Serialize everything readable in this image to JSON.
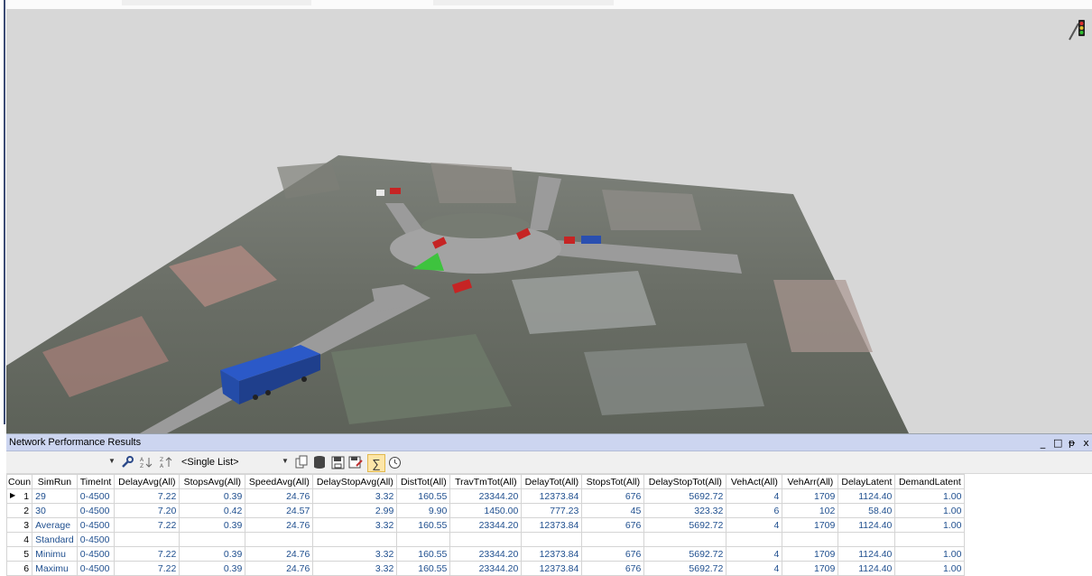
{
  "panel": {
    "title": "Network Performance Results",
    "controls": {
      "minimize": "_",
      "maximize": "□",
      "pin": "ᵽ",
      "close": "x"
    }
  },
  "toolbar": {
    "list_select": "<Single List>"
  },
  "table": {
    "headers": [
      "Coun",
      "SimRun",
      "TimeInt",
      "DelayAvg(All)",
      "StopsAvg(All)",
      "SpeedAvg(All)",
      "DelayStopAvg(All)",
      "DistTot(All)",
      "TravTmTot(All)",
      "DelayTot(All)",
      "StopsTot(All)",
      "DelayStopTot(All)",
      "VehAct(All)",
      "VehArr(All)",
      "DelayLatent",
      "DemandLatent"
    ],
    "rows": [
      {
        "coun": "1",
        "simrun": "29",
        "timeint": "0-4500",
        "delayavg": "7.22",
        "stopsavg": "0.39",
        "speedavg": "24.76",
        "delaystopavg": "3.32",
        "disttot": "160.55",
        "travtmtot": "23344.20",
        "delaytot": "12373.84",
        "stopstot": "676",
        "delaystoptot": "5692.72",
        "vehact": "4",
        "veharr": "1709",
        "delaylatent": "1124.40",
        "demandlatent": "1.00"
      },
      {
        "coun": "2",
        "simrun": "30",
        "timeint": "0-4500",
        "delayavg": "7.20",
        "stopsavg": "0.42",
        "speedavg": "24.57",
        "delaystopavg": "2.99",
        "disttot": "9.90",
        "travtmtot": "1450.00",
        "delaytot": "777.23",
        "stopstot": "45",
        "delaystoptot": "323.32",
        "vehact": "6",
        "veharr": "102",
        "delaylatent": "58.40",
        "demandlatent": "1.00"
      },
      {
        "coun": "3",
        "simrun": "Average",
        "timeint": "0-4500",
        "delayavg": "7.22",
        "stopsavg": "0.39",
        "speedavg": "24.76",
        "delaystopavg": "3.32",
        "disttot": "160.55",
        "travtmtot": "23344.20",
        "delaytot": "12373.84",
        "stopstot": "676",
        "delaystoptot": "5692.72",
        "vehact": "4",
        "veharr": "1709",
        "delaylatent": "1124.40",
        "demandlatent": "1.00"
      },
      {
        "coun": "4",
        "simrun": "Standard",
        "timeint": "0-4500",
        "delayavg": "",
        "stopsavg": "",
        "speedavg": "",
        "delaystopavg": "",
        "disttot": "",
        "travtmtot": "",
        "delaytot": "",
        "stopstot": "",
        "delaystoptot": "",
        "vehact": "",
        "veharr": "",
        "delaylatent": "",
        "demandlatent": ""
      },
      {
        "coun": "5",
        "simrun": "Minimu",
        "timeint": "0-4500",
        "delayavg": "7.22",
        "stopsavg": "0.39",
        "speedavg": "24.76",
        "delaystopavg": "3.32",
        "disttot": "160.55",
        "travtmtot": "23344.20",
        "delaytot": "12373.84",
        "stopstot": "676",
        "delaystoptot": "5692.72",
        "vehact": "4",
        "veharr": "1709",
        "delaylatent": "1124.40",
        "demandlatent": "1.00"
      },
      {
        "coun": "6",
        "simrun": "Maximu",
        "timeint": "0-4500",
        "delayavg": "7.22",
        "stopsavg": "0.39",
        "speedavg": "24.76",
        "delaystopavg": "3.32",
        "disttot": "160.55",
        "travtmtot": "23344.20",
        "delaytot": "12373.84",
        "stopstot": "676",
        "delaystoptot": "5692.72",
        "vehact": "4",
        "veharr": "1709",
        "delaylatent": "1124.40",
        "demandlatent": "1.00"
      }
    ]
  },
  "icons": {
    "viewport": "traffic-signal-icon",
    "toolbar": [
      "wrench-icon",
      "sort-ascending-icon",
      "sort-descending-icon",
      "copy-icon",
      "database-icon",
      "save-icon",
      "save-as-icon",
      "sum-icon",
      "time-icon"
    ]
  },
  "colors": {
    "panel_title_bg": "#ccd5f0",
    "cell_text": "#1f4f8f",
    "truck": "#2b59c8",
    "car_red": "#c62424",
    "green_area": "#3ec33e"
  }
}
